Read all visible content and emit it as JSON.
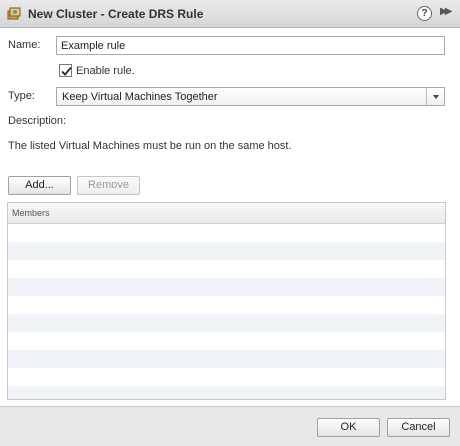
{
  "window": {
    "title": "New Cluster - Create DRS Rule",
    "help_glyph": "?",
    "expand_glyph": "▶▶"
  },
  "form": {
    "name_label": "Name:",
    "name_value": "Example rule",
    "enable_label": "Enable rule.",
    "enable_checked": true,
    "type_label": "Type:",
    "type_value": "Keep Virtual Machines Together",
    "description_label": "Description:",
    "description_text": "The listed Virtual Machines must be run on the same host."
  },
  "toolbar": {
    "add_label": "Add...",
    "remove_label": "Remove",
    "remove_enabled": false
  },
  "members_table": {
    "column_header": "Members",
    "rows": []
  },
  "footer": {
    "ok_label": "OK",
    "cancel_label": "Cancel"
  },
  "colors": {
    "titlebar": "#dcdcdc",
    "row_stripe": "#f0f4f8",
    "footer": "#e8e8e8",
    "checkmark": "#2b2b2b"
  },
  "icons": {
    "title": "drs-rule-icon",
    "help": "help-icon",
    "expand": "double-chevron-right-icon",
    "dropdown": "chevron-down-icon"
  }
}
